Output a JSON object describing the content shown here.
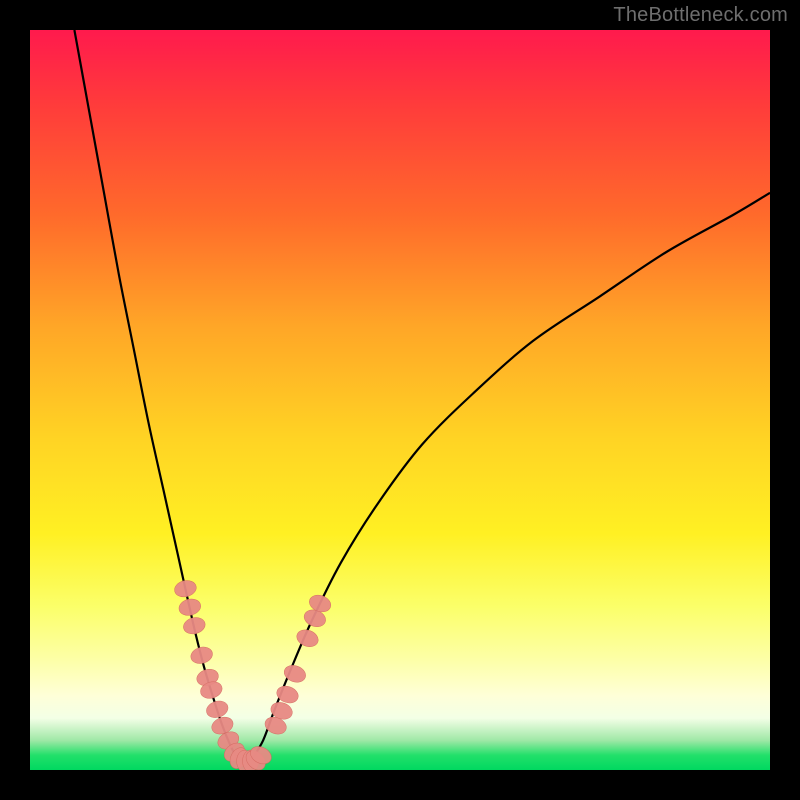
{
  "watermark": "TheBottleneck.com",
  "colors": {
    "curve": "#000000",
    "marker_fill": "#e88a84",
    "marker_stroke": "#d46a60"
  },
  "chart_data": {
    "type": "line",
    "title": "",
    "xlabel": "",
    "ylabel": "",
    "xlim": [
      0,
      100
    ],
    "ylim": [
      0,
      100
    ],
    "grid": false,
    "legend": false,
    "series": [
      {
        "name": "left-branch",
        "x": [
          6,
          8,
          10,
          12,
          14,
          16,
          18,
          20,
          22,
          23.5,
          25,
          26,
          27,
          28
        ],
        "y": [
          100,
          89,
          78,
          67,
          57,
          47,
          38,
          29,
          20,
          14,
          9,
          6,
          3.5,
          1.5
        ]
      },
      {
        "name": "right-branch",
        "x": [
          30,
          31.5,
          33,
          35,
          38,
          42,
          47,
          53,
          60,
          68,
          77,
          86,
          95,
          100
        ],
        "y": [
          1.5,
          4,
          8,
          13,
          20,
          28,
          36,
          44,
          51,
          58,
          64,
          70,
          75,
          78
        ]
      }
    ],
    "markers_left": {
      "name": "left-branch-markers",
      "points": [
        {
          "x": 21.0,
          "y": 24.5
        },
        {
          "x": 21.6,
          "y": 22.0
        },
        {
          "x": 22.2,
          "y": 19.5
        },
        {
          "x": 23.2,
          "y": 15.5
        },
        {
          "x": 24.0,
          "y": 12.5
        },
        {
          "x": 24.5,
          "y": 10.8
        },
        {
          "x": 25.3,
          "y": 8.2
        },
        {
          "x": 26.0,
          "y": 6.0
        },
        {
          "x": 26.8,
          "y": 4.0
        },
        {
          "x": 27.6,
          "y": 2.4
        },
        {
          "x": 28.2,
          "y": 1.6
        },
        {
          "x": 29.0,
          "y": 1.2
        },
        {
          "x": 29.8,
          "y": 1.2
        }
      ]
    },
    "markers_right": {
      "name": "right-branch-markers",
      "points": [
        {
          "x": 30.5,
          "y": 1.3
        },
        {
          "x": 31.2,
          "y": 2.0
        },
        {
          "x": 33.2,
          "y": 6.0
        },
        {
          "x": 34.0,
          "y": 8.0
        },
        {
          "x": 34.8,
          "y": 10.2
        },
        {
          "x": 35.8,
          "y": 13.0
        },
        {
          "x": 37.5,
          "y": 17.8
        },
        {
          "x": 38.5,
          "y": 20.5
        },
        {
          "x": 39.2,
          "y": 22.5
        }
      ]
    }
  }
}
